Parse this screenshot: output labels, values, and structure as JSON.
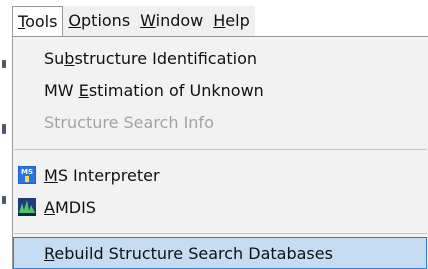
{
  "menubar": {
    "items": [
      {
        "pre": "",
        "key": "T",
        "post": "ools"
      },
      {
        "pre": "",
        "key": "O",
        "post": "ptions"
      },
      {
        "pre": "",
        "key": "W",
        "post": "indow"
      },
      {
        "pre": "",
        "key": "H",
        "post": "elp"
      }
    ],
    "active_index": 0
  },
  "tools_menu": {
    "items": [
      {
        "pre": "Su",
        "key": "b",
        "post": "structure Identification",
        "enabled": true
      },
      {
        "pre": "MW ",
        "key": "E",
        "post": "stimation of Unknown",
        "enabled": true
      },
      {
        "pre": "Structure Search Info",
        "key": "",
        "post": "",
        "enabled": false
      },
      {
        "pre": "",
        "key": "M",
        "post": "S Interpreter",
        "enabled": true,
        "icon": "ms-interpreter-icon"
      },
      {
        "pre": "",
        "key": "A",
        "post": "MDIS",
        "enabled": true,
        "icon": "amdis-icon"
      },
      {
        "pre": "",
        "key": "R",
        "post": "ebuild Structure Search Databases",
        "enabled": true,
        "highlighted": true
      }
    ]
  },
  "colors": {
    "highlight_bg": "#c5dcf3",
    "highlight_border": "#2f7fd6",
    "disabled_text": "#a3a3a3"
  }
}
